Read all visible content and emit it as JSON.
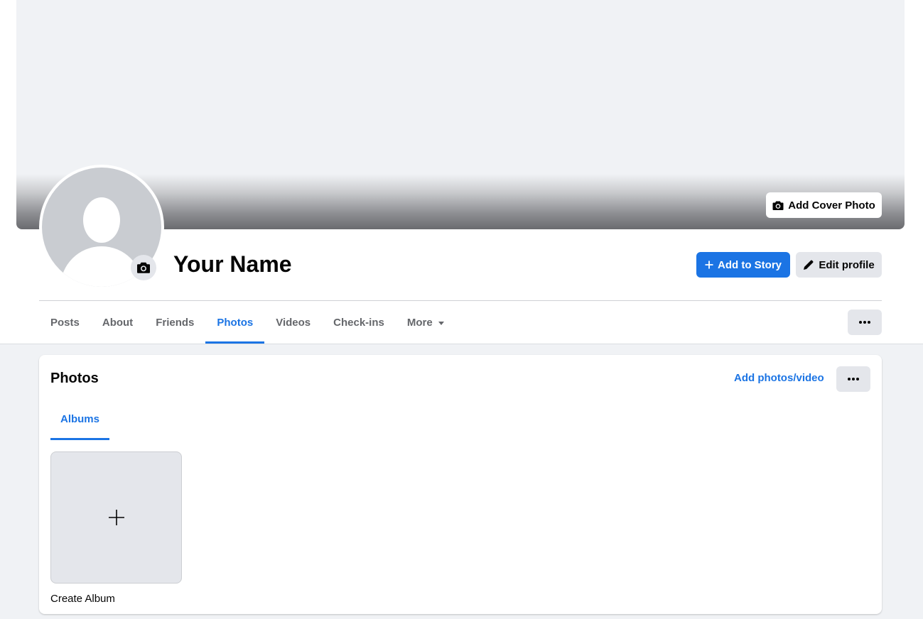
{
  "profile": {
    "name": "Your Name",
    "add_cover_label": "Add Cover Photo",
    "add_to_story_label": "Add to Story",
    "edit_profile_label": "Edit profile"
  },
  "tabs": [
    {
      "label": "Posts",
      "active": false
    },
    {
      "label": "About",
      "active": false
    },
    {
      "label": "Friends",
      "active": false
    },
    {
      "label": "Photos",
      "active": true
    },
    {
      "label": "Videos",
      "active": false
    },
    {
      "label": "Check-ins",
      "active": false
    },
    {
      "label": "More",
      "active": false
    }
  ],
  "photos": {
    "title": "Photos",
    "add_label": "Add photos/video",
    "subtab": "Albums",
    "create_album_label": "Create Album"
  },
  "colors": {
    "accent": "#1b74e4",
    "background": "#f0f2f5",
    "secondary_button": "#e4e6eb",
    "muted_text": "#65676b"
  },
  "icons": {
    "cover_button": "camera-icon",
    "avatar_button": "camera-icon",
    "story_button": "plus-icon",
    "edit_button": "pencil-icon",
    "more_tab": "caret-down-icon",
    "overflow": "more-dots-icon",
    "create_album": "plus-icon"
  }
}
